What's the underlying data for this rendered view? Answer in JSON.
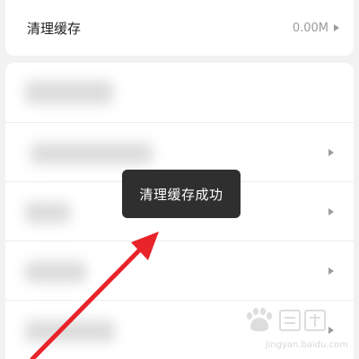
{
  "settings": {
    "cache_title": "清理缓存",
    "cache_value": "0.00M"
  },
  "toast": {
    "message": "清理缓存成功"
  },
  "colors": {
    "annotation_arrow": "#e8232a",
    "toast_bg": "#2f2f2f"
  },
  "watermark": {
    "url_text": "jingyan.baidu.com"
  }
}
